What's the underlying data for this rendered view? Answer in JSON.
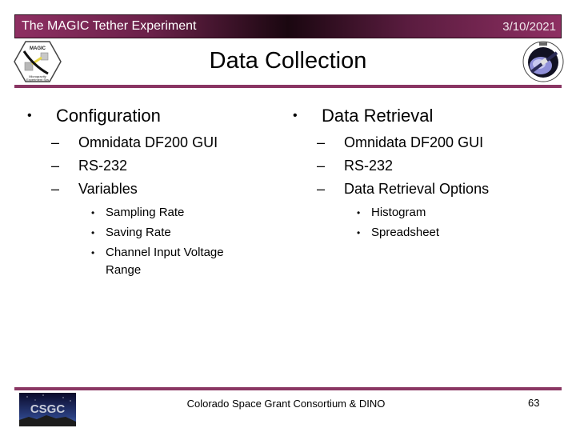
{
  "header": {
    "title": "The MAGIC Tether Experiment",
    "date": "3/10/2021"
  },
  "slide": {
    "title": "Data Collection",
    "columns": [
      {
        "heading": "Configuration",
        "items": [
          "Omnidata DF200 GUI",
          "RS-232",
          "Variables"
        ],
        "subitems": [
          "Sampling Rate",
          "Saving Rate",
          "Channel Input Voltage Range"
        ]
      },
      {
        "heading": "Data Retrieval",
        "items": [
          "Omnidata DF200 GUI",
          "RS-232",
          "Data Retrieval Options"
        ],
        "subitems": [
          "Histogram",
          "Spreadsheet"
        ]
      }
    ]
  },
  "footer": {
    "text": "Colorado Space Grant Consortium & DINO",
    "page_number": "63"
  },
  "logos": {
    "left": "magic-mission-logo",
    "right": "dino-mission-logo",
    "bottom": "CSGC"
  },
  "colors": {
    "accent": "#8a3663",
    "header_dark": "#1a0710"
  },
  "bullets": {
    "l1": "•",
    "l2": "–",
    "l3": "•"
  }
}
